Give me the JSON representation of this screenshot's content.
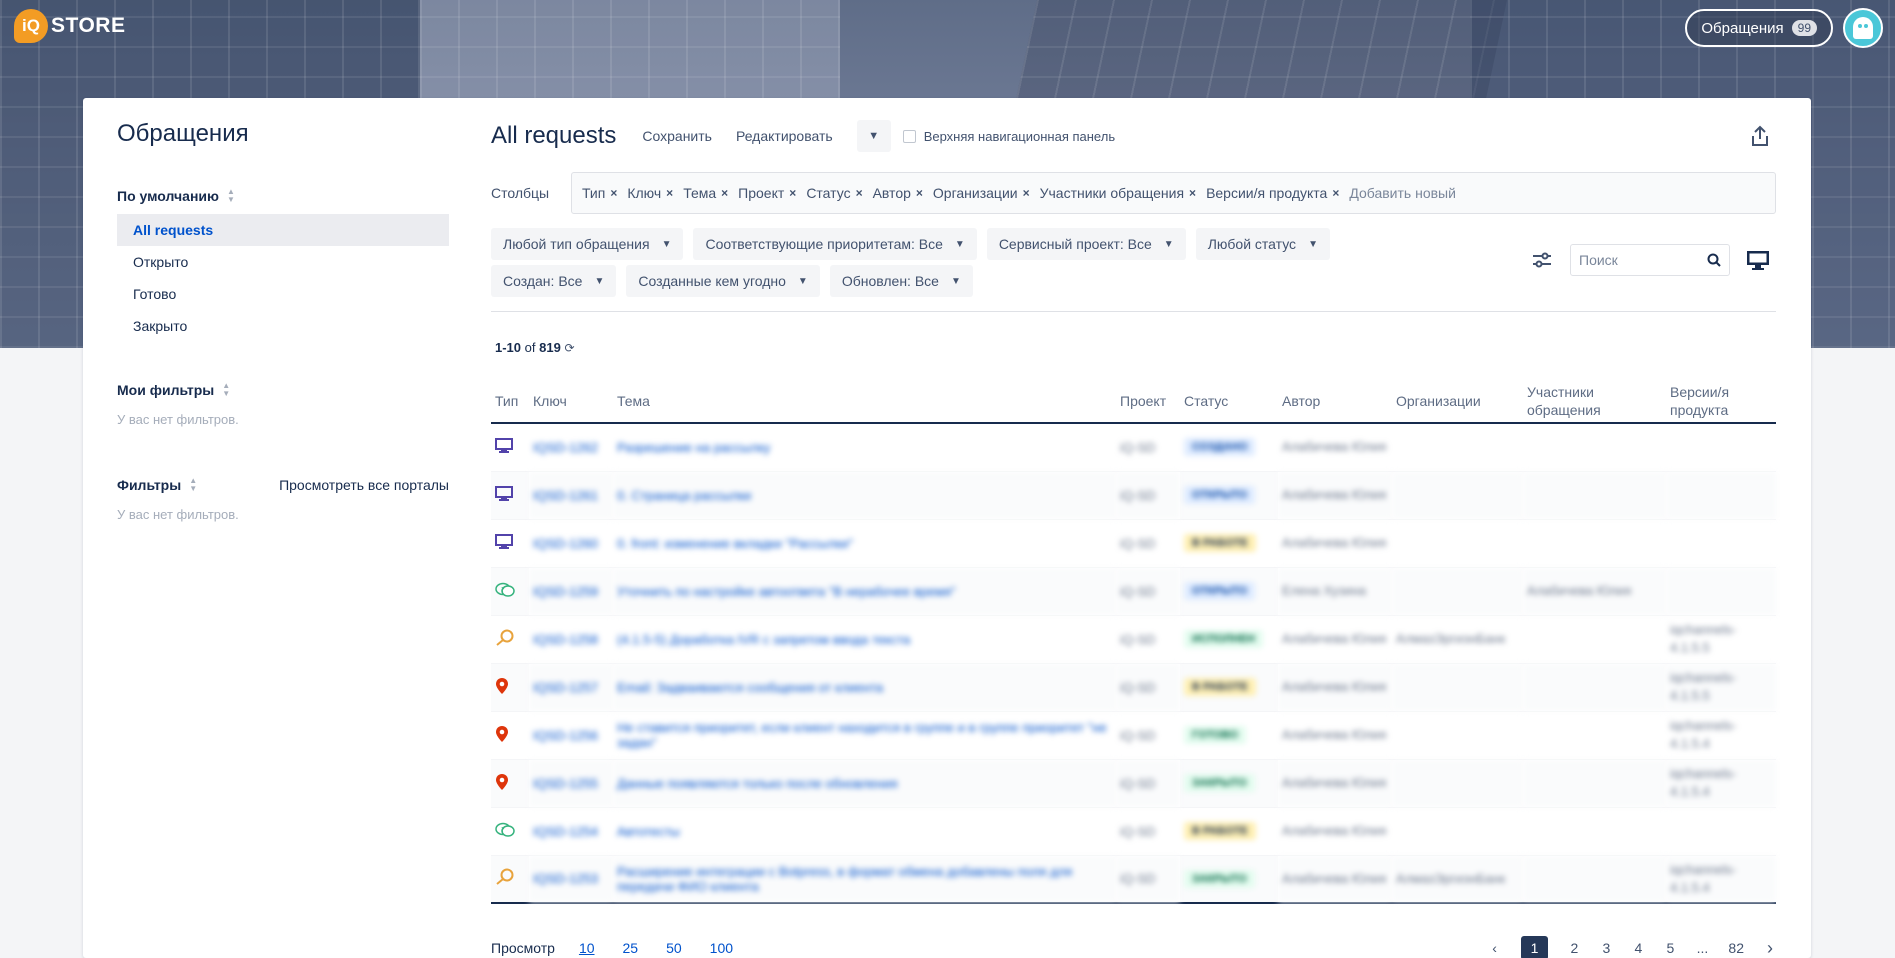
{
  "brand": {
    "logo_mark": "iQ",
    "logo_text": "STORE"
  },
  "header": {
    "requests_label": "Обращения",
    "requests_count": "99",
    "avatar_icon": "ghost-avatar-icon"
  },
  "sidebar": {
    "title": "Обращения",
    "default_section": "По умолчанию",
    "default_items": [
      {
        "label": "All requests",
        "active": true
      },
      {
        "label": "Открыто"
      },
      {
        "label": "Готово"
      },
      {
        "label": "Закрыто"
      }
    ],
    "my_filters_title": "Мои фильтры",
    "my_filters_empty": "У вас нет фильтров.",
    "filters_title": "Фильтры",
    "view_all_portals": "Просмотреть все порталы",
    "filters_empty": "У вас нет фильтров."
  },
  "main": {
    "title": "All requests",
    "save_label": "Сохранить",
    "edit_label": "Редактировать",
    "top_nav_label": "Верхняя навигационная панель",
    "columns_label": "Столбцы",
    "column_tags": [
      "Тип",
      "Ключ",
      "Тема",
      "Проект",
      "Статус",
      "Автор",
      "Организации",
      "Участники обращения",
      "Версии/я продукта"
    ],
    "add_new": "Добавить новый",
    "filters_row1": [
      "Любой тип обращения",
      "Соответствующие приоритетам: Все",
      "Сервисный проект: Все",
      "Любой статус"
    ],
    "filters_row2": [
      "Создан: Все",
      "Созданные кем угодно",
      "Обновлен: Все"
    ],
    "search_placeholder": "Поиск",
    "count_range": "1-10",
    "count_of": "of",
    "count_total": "819"
  },
  "table": {
    "headers": [
      "Тип",
      "Ключ",
      "Тема",
      "Проект",
      "Статус",
      "Автор",
      "Организации",
      "Участники обращения",
      "Версии/я продукта"
    ],
    "rows": [
      {
        "type_icon": "monitor-icon",
        "key": "IQSD-1262",
        "summary": "Разрешение на рассылку",
        "project": "iQ-SD",
        "status": "СОЗДАНО",
        "status_kind": "new",
        "author": "Алабичева Юлия",
        "org": "",
        "participants": "",
        "version": ""
      },
      {
        "type_icon": "monitor-icon",
        "key": "IQSD-1261",
        "summary": "0. Страница рассылки",
        "project": "iQ-SD",
        "status": "ОТКРЫТО",
        "status_kind": "open",
        "author": "Алабичева Юлия",
        "org": "",
        "participants": "",
        "version": ""
      },
      {
        "type_icon": "monitor-icon",
        "key": "IQSD-1260",
        "summary": "0. front: изменение вкладки \"Рассылки\"",
        "project": "iQ-SD",
        "status": "В РАБОТЕ",
        "status_kind": "work",
        "author": "Алабичева Юлия",
        "org": "",
        "participants": "",
        "version": ""
      },
      {
        "type_icon": "question-bubble-icon",
        "key": "IQSD-1259",
        "summary": "Уточнить по настройке автоответа \"В нерабочее время\"",
        "project": "iQ-SD",
        "status": "ОТКРЫТО",
        "status_kind": "open",
        "author": "Елена Хузина",
        "org": "",
        "participants": "Алабичева Юлия",
        "version": ""
      },
      {
        "type_icon": "magnifier-icon",
        "key": "IQSD-1258",
        "summary": "(4.1.5-5) Доработка IVR с запретом ввода текста",
        "project": "iQ-SD",
        "status": "ИСПОЛНЕН",
        "status_kind": "done",
        "author": "Алабичева Юлия",
        "org": "АлмазЭргиэнБанк",
        "participants": "",
        "version": "iqchannels-4.1.5.5"
      },
      {
        "type_icon": "map-pin-icon",
        "key": "IQSD-1257",
        "summary": "Email: Задваиваются сообщения от клиента",
        "project": "iQ-SD",
        "status": "В РАБОТЕ",
        "status_kind": "work",
        "author": "Алабичева Юлия",
        "org": "",
        "participants": "",
        "version": "iqchannels-4.1.5.5"
      },
      {
        "type_icon": "map-pin-icon",
        "key": "IQSD-1256",
        "summary": "Не ставится приоритет, если клиент находится в группе и в группе приоритет \"не задан\"",
        "project": "iQ-SD",
        "status": "ГОТОВО",
        "status_kind": "done",
        "author": "Алабичева Юлия",
        "org": "",
        "participants": "",
        "version": "iqchannels-4.1.5.4"
      },
      {
        "type_icon": "map-pin-icon",
        "key": "IQSD-1255",
        "summary": "Данные появляются только после обновления",
        "project": "iQ-SD",
        "status": "ЗАКРЫТО",
        "status_kind": "done",
        "author": "Алабичева Юлия",
        "org": "",
        "participants": "",
        "version": "iqchannels-4.1.5.4"
      },
      {
        "type_icon": "question-bubble-icon",
        "key": "IQSD-1254",
        "summary": "Автотесты",
        "project": "iQ-SD",
        "status": "В РАБОТЕ",
        "status_kind": "work",
        "author": "Алабичева Юлия",
        "org": "",
        "participants": "",
        "version": ""
      },
      {
        "type_icon": "magnifier-icon",
        "key": "IQSD-1253",
        "summary": "Расширение интеграции с Botpress, в формат обмена добавлены поля для передачи ФИО клиента",
        "project": "iQ-SD",
        "status": "ЗАКРЫТО",
        "status_kind": "done",
        "author": "Алабичева Юлия",
        "org": "АлмазЭргиэнБанк",
        "participants": "",
        "version": "iqchannels-4.1.5.4"
      }
    ]
  },
  "pager": {
    "label": "Просмотр",
    "sizes": [
      "10",
      "25",
      "50",
      "100"
    ],
    "selected_size": "10",
    "pages": [
      "1",
      "2",
      "3",
      "4",
      "5",
      "...",
      "82"
    ],
    "current_page": "1"
  },
  "colors": {
    "accent": "#0052cc",
    "dark": "#172b4d",
    "logo": "#f39c24",
    "avatar": "#4bc7d8"
  }
}
